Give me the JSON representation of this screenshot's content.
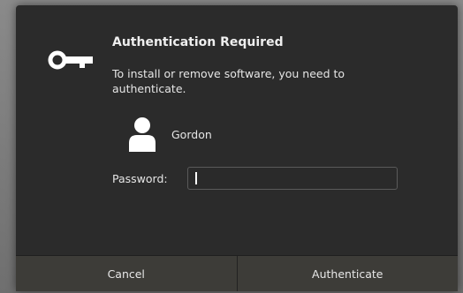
{
  "dialog": {
    "title": "Authentication Required",
    "message": "To install or remove software, you need to authenticate.",
    "user": {
      "name": "Gordon"
    },
    "password": {
      "label": "Password:",
      "value": "",
      "placeholder": ""
    },
    "buttons": {
      "cancel_label": "Cancel",
      "authenticate_label": "Authenticate"
    }
  },
  "colors": {
    "dialog_bg": "#2b2b2b",
    "button_bar_bg": "#3d3c38",
    "text": "#e6e6e6",
    "input_border": "#5a5a5a"
  },
  "icons": {
    "dialog_icon": "key-icon",
    "user_icon": "user-avatar-icon"
  }
}
